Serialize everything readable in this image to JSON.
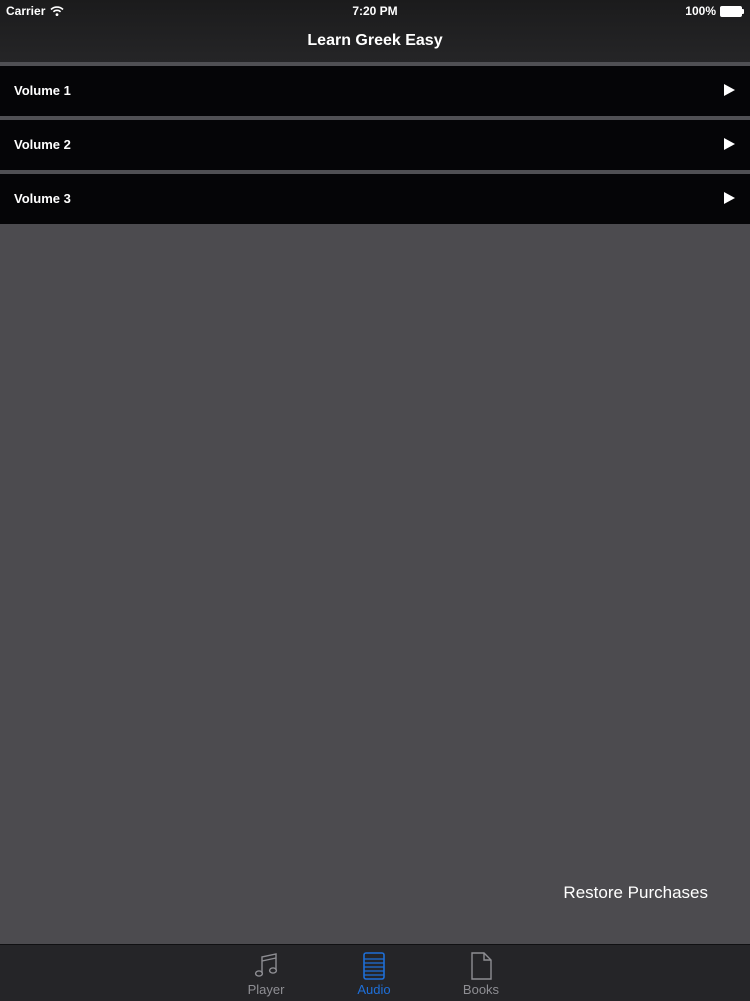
{
  "status_bar": {
    "carrier": "Carrier",
    "time": "7:20 PM",
    "battery": "100%"
  },
  "nav": {
    "title": "Learn Greek Easy"
  },
  "volumes": [
    {
      "label": "Volume 1"
    },
    {
      "label": "Volume 2"
    },
    {
      "label": "Volume 3"
    }
  ],
  "restore_label": "Restore Purchases",
  "tabs": [
    {
      "label": "Player",
      "icon": "music-note-icon",
      "active": false
    },
    {
      "label": "Audio",
      "icon": "list-icon",
      "active": true
    },
    {
      "label": "Books",
      "icon": "document-icon",
      "active": false
    }
  ],
  "colors": {
    "accent": "#1e6fd8",
    "background": "#4c4b4f",
    "row_background": "#050507"
  }
}
